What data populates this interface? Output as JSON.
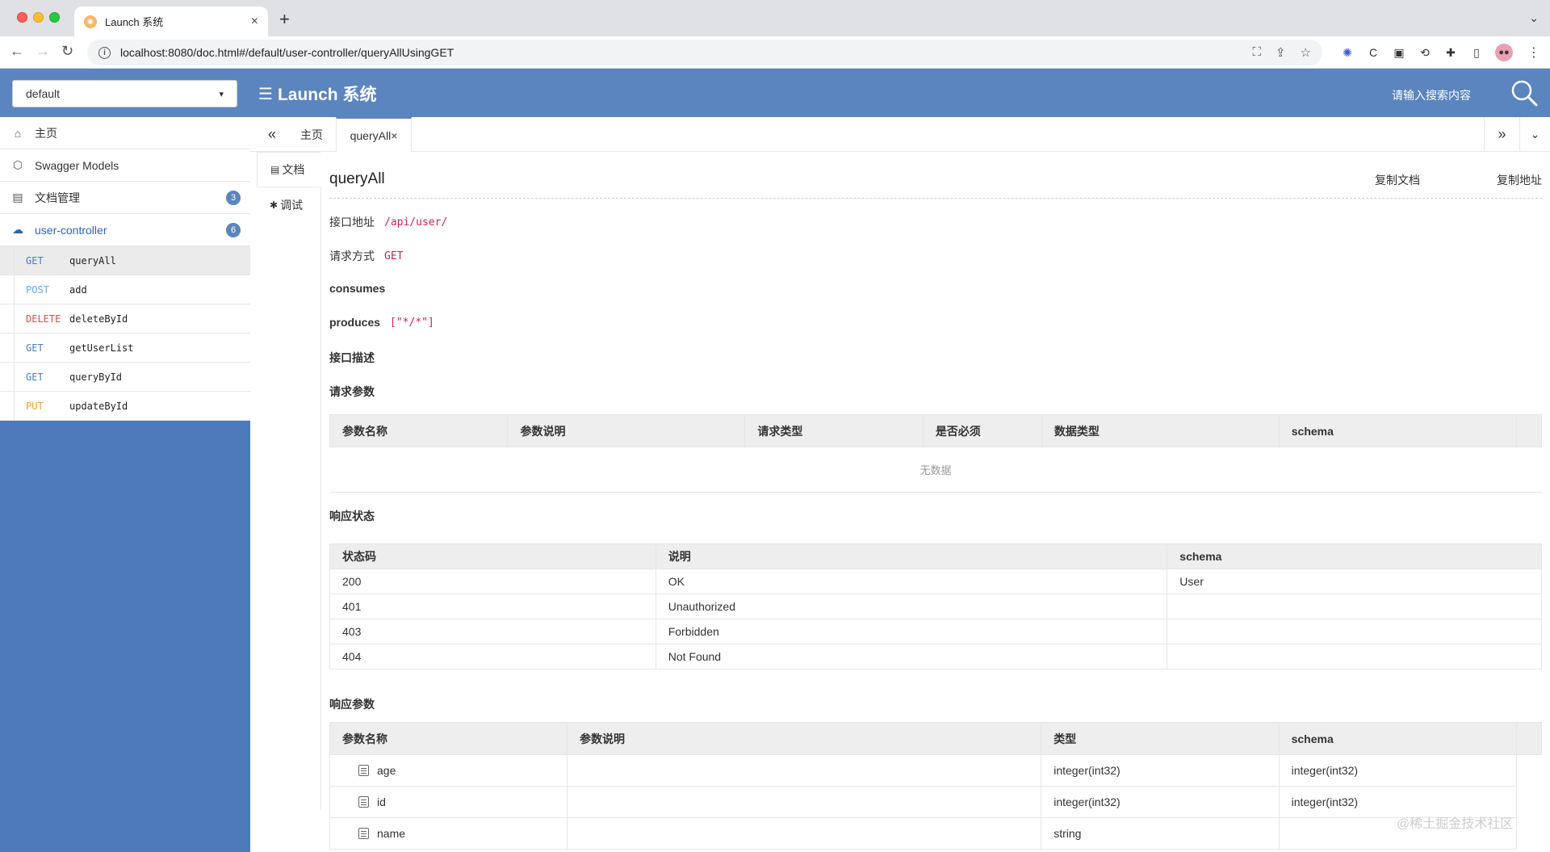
{
  "browser": {
    "tab_title": "Launch 系统",
    "url": "localhost:8080/doc.html#/default/user-controller/queryAllUsingGET"
  },
  "header": {
    "group_selected": "default",
    "brand": "Launch 系统",
    "search_placeholder": "请输入搜索内容",
    "accent_color": "#5b85be"
  },
  "sidebar": {
    "items": [
      {
        "label": "主页",
        "icon": "home-icon"
      },
      {
        "label": "Swagger Models",
        "icon": "models-icon"
      },
      {
        "label": "文档管理",
        "icon": "doc-manage-icon",
        "badge": "3"
      },
      {
        "label": "user-controller",
        "icon": "cloud-icon",
        "badge": "6"
      }
    ],
    "apis": [
      {
        "method": "GET",
        "name": "queryAll"
      },
      {
        "method": "POST",
        "name": "add"
      },
      {
        "method": "DELETE",
        "name": "deleteById"
      },
      {
        "method": "GET",
        "name": "getUserList"
      },
      {
        "method": "GET",
        "name": "queryById"
      },
      {
        "method": "PUT",
        "name": "updateById"
      }
    ]
  },
  "content_tabs": {
    "home": "主页",
    "active": "queryAll"
  },
  "vtabs": {
    "doc": "文档",
    "debug": "调试"
  },
  "doc": {
    "title": "queryAll",
    "copy_doc": "复制文档",
    "copy_url": "复制地址",
    "address_label": "接口地址",
    "address": "/api/user/",
    "method_label": "请求方式",
    "method": "GET",
    "consumes_label": "consumes",
    "produces_label": "produces",
    "produces": "[\"*/*\"]",
    "desc_label": "接口描述",
    "req_params_label": "请求参数",
    "req_params_headers": [
      "参数名称",
      "参数说明",
      "请求类型",
      "是否必须",
      "数据类型",
      "schema"
    ],
    "no_data": "无数据",
    "resp_status_label": "响应状态",
    "resp_status_headers": [
      "状态码",
      "说明",
      "schema"
    ],
    "resp_status_rows": [
      [
        "200",
        "OK",
        "User"
      ],
      [
        "401",
        "Unauthorized",
        ""
      ],
      [
        "403",
        "Forbidden",
        ""
      ],
      [
        "404",
        "Not Found",
        ""
      ]
    ],
    "resp_params_label": "响应参数",
    "resp_params_headers": [
      "参数名称",
      "参数说明",
      "类型",
      "schema"
    ],
    "resp_params_rows": [
      [
        "age",
        "",
        "integer(int32)",
        "integer(int32)"
      ],
      [
        "id",
        "",
        "integer(int32)",
        "integer(int32)"
      ],
      [
        "name",
        "",
        "string",
        ""
      ]
    ]
  },
  "watermark": "@稀土掘金技术社区"
}
